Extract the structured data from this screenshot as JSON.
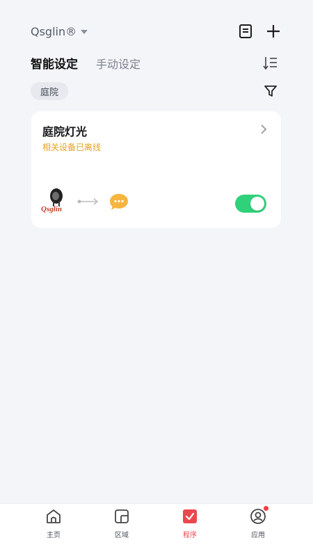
{
  "header": {
    "home_name": "Qsglin®",
    "icons": {
      "log": "document-icon",
      "add": "plus-icon",
      "sort": "sort-icon",
      "filter": "filter-icon"
    }
  },
  "tabs": [
    {
      "label": "智能设定",
      "active": true
    },
    {
      "label": "手动设定",
      "active": false
    }
  ],
  "filter_chip": "庭院",
  "card": {
    "title": "庭院灯光",
    "status": "相关设备已离线",
    "device_brand": "Qsglin",
    "enabled": true
  },
  "tabbar": [
    {
      "label": "主页",
      "icon": "home-icon"
    },
    {
      "label": "区域",
      "icon": "area-icon"
    },
    {
      "label": "程序",
      "icon": "program-check-icon",
      "active": true
    },
    {
      "label": "应用",
      "icon": "profile-icon",
      "badge": true
    }
  ],
  "colors": {
    "accent": "#e9484f",
    "toggle_on": "#2fd17a",
    "warning": "#e5a21d",
    "background": "#f4f5f9"
  }
}
